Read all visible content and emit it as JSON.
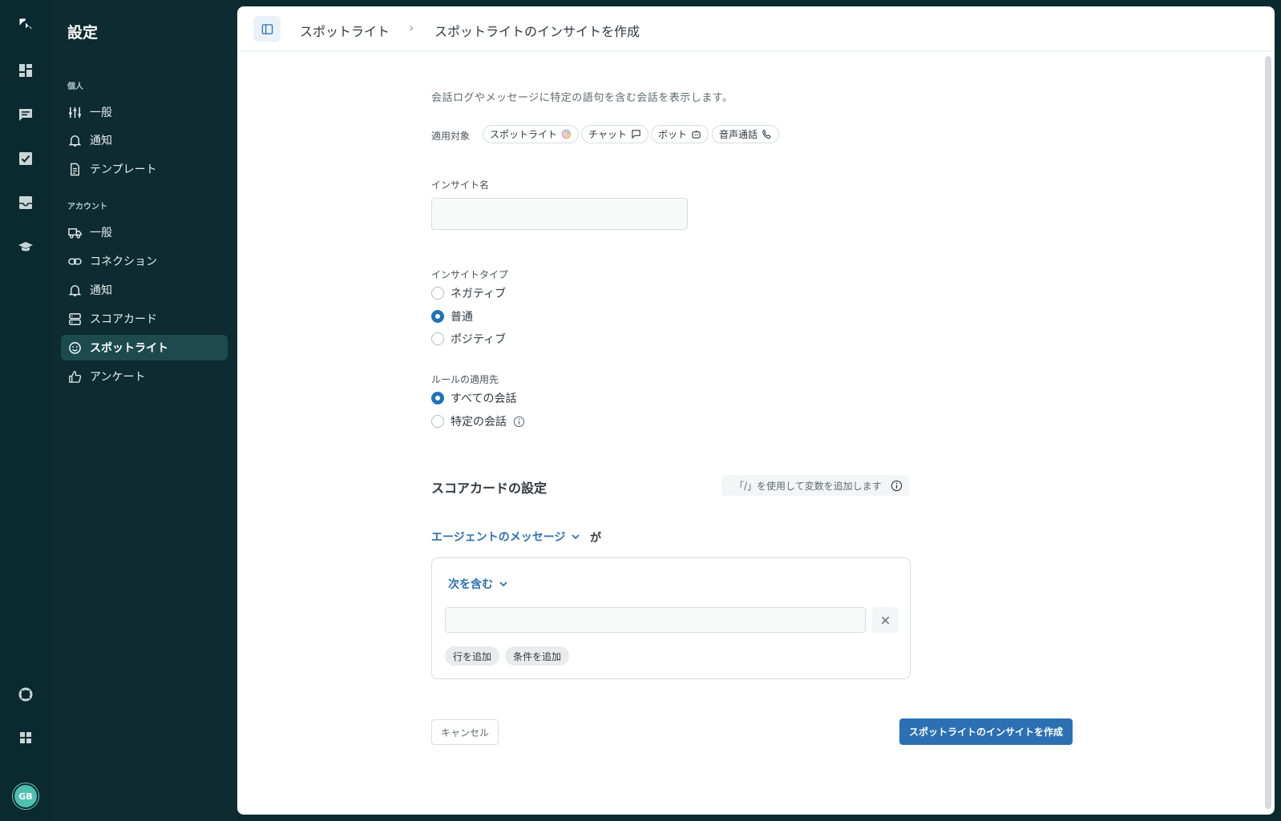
{
  "rail": {
    "items": [
      "zendesk-logo",
      "dashboard",
      "conversations",
      "tasks",
      "inbox",
      "learning",
      "help",
      "apps"
    ],
    "avatar_initials": "GB"
  },
  "sidebar": {
    "title": "設定",
    "personal_section": "個人",
    "personal_items": [
      {
        "label": "一般",
        "icon": "sliders-icon"
      },
      {
        "label": "通知",
        "icon": "bell-icon"
      },
      {
        "label": "テンプレート",
        "icon": "document-icon"
      }
    ],
    "account_section": "アカウント",
    "account_items": [
      {
        "label": "一般",
        "icon": "truck-icon"
      },
      {
        "label": "コネクション",
        "icon": "link-icon"
      },
      {
        "label": "通知",
        "icon": "bell-icon"
      },
      {
        "label": "スコアカード",
        "icon": "server-icon"
      },
      {
        "label": "スポットライト",
        "icon": "smiley-icon",
        "active": true
      },
      {
        "label": "アンケート",
        "icon": "thumbs-up-icon"
      }
    ]
  },
  "header": {
    "breadcrumb_parent": "スポットライト",
    "breadcrumb_separator": "›",
    "breadcrumb_current": "スポットライトのインサイトを作成"
  },
  "form": {
    "description": "会話ログやメッセージに特定の語句を含む会話を表示します。",
    "applies_to_label": "適用対象",
    "applies_to_chips": [
      {
        "label": "スポットライト",
        "icon": "spotlight-icon"
      },
      {
        "label": "チャット",
        "icon": "chat-bubble-icon"
      },
      {
        "label": "ボット",
        "icon": "bot-icon"
      },
      {
        "label": "音声通話",
        "icon": "phone-icon"
      }
    ],
    "insight_name_label": "インサイト名",
    "insight_name_value": "",
    "insight_type_label": "インサイトタイプ",
    "insight_type_options": [
      "ネガティブ",
      "普通",
      "ポジティブ"
    ],
    "insight_type_selected": "普通",
    "rule_target_label": "ルールの適用先",
    "rule_target_options": [
      "すべての会話",
      "特定の会話"
    ],
    "rule_target_selected": "すべての会話",
    "scorecard_title": "スコアカードの設定",
    "variable_hint": "「/」を使用して変数を追加します",
    "agent_dropdown": "エージェントのメッセージ",
    "agent_suffix": "が",
    "condition_dropdown": "次を含む",
    "condition_value": "",
    "add_row": "行を追加",
    "add_condition": "条件を追加",
    "cancel": "キャンセル",
    "submit": "スポットライトのインサイトを作成"
  },
  "colors": {
    "accent": "#2b70b3",
    "sidebar_bg": "#0d2b30",
    "rail_bg": "#0a2a2f",
    "active_item_bg": "#1d4a4f"
  }
}
